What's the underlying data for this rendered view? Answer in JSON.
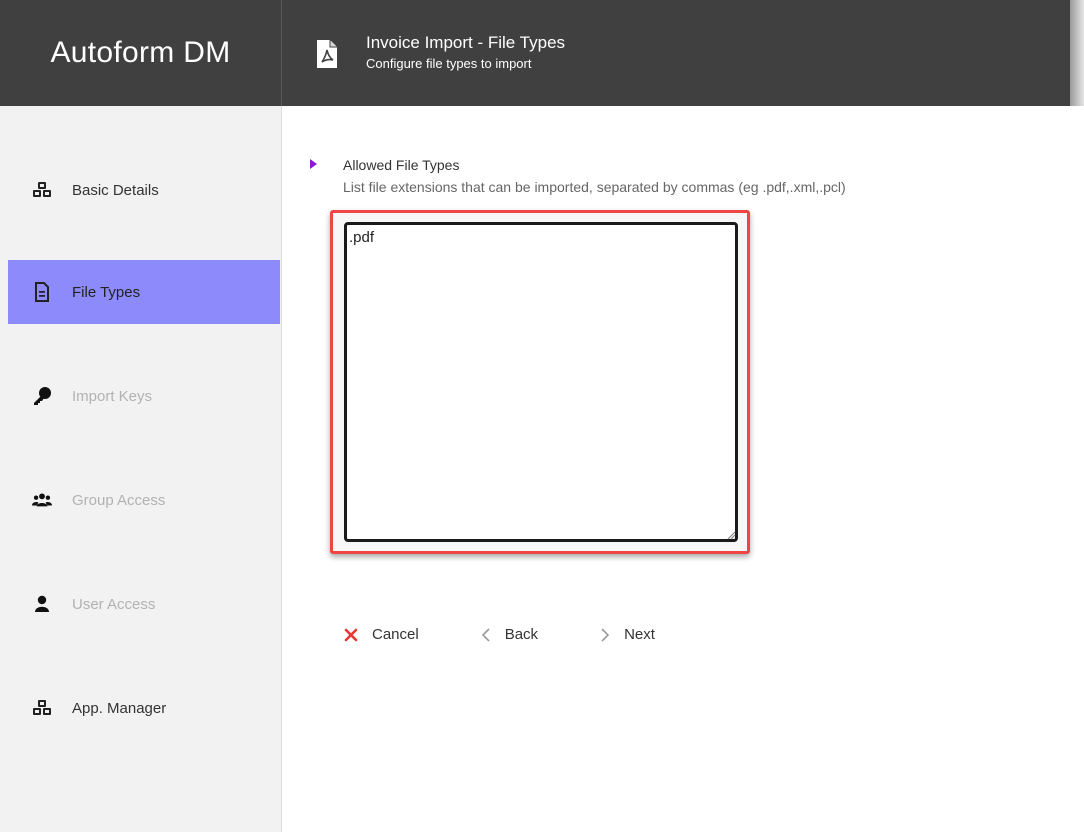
{
  "header": {
    "brand": "Autoform DM",
    "title": "Invoice Import - File Types",
    "subtitle": "Configure file types to import",
    "icon": "pdf-file-icon",
    "background": "#404040"
  },
  "sidebar": {
    "items": [
      {
        "label": "Basic Details",
        "icon": "cubes-icon",
        "state": "normal"
      },
      {
        "label": "File Types",
        "icon": "file-text-icon",
        "state": "active"
      },
      {
        "label": "Import Keys",
        "icon": "key-icon",
        "state": "disabled"
      },
      {
        "label": "Group Access",
        "icon": "users-icon",
        "state": "disabled"
      },
      {
        "label": "User Access",
        "icon": "user-icon",
        "state": "disabled"
      },
      {
        "label": "App. Manager",
        "icon": "cubes-icon",
        "state": "normal"
      }
    ],
    "active_color": "#8d8afc"
  },
  "main": {
    "section_label": "Allowed File Types",
    "section_description": "List file extensions that can be imported, separated by commas (eg .pdf,.xml,.pcl)",
    "file_types_value": ".pdf",
    "highlight_color": "#ef4545",
    "caret_color": "#8b1ad6"
  },
  "actions": {
    "cancel_label": "Cancel",
    "back_label": "Back",
    "next_label": "Next",
    "cancel_color": "#e53935"
  }
}
